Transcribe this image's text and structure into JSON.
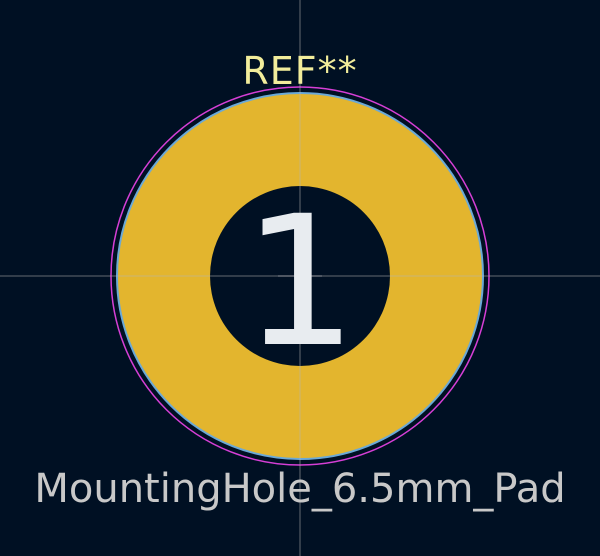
{
  "footprint": {
    "reference": "REF**",
    "value": "MountingHole_6.5mm_Pad",
    "pad_number": "1"
  },
  "colors": {
    "background": "#001023",
    "pad_copper": "#e3b52e",
    "pad_outline": "#6ba9d6",
    "courtyard": "#d63fd6",
    "drill_hole": "#001023",
    "crosshair": "#b4b4b4",
    "reference_text": "#f2ed9b",
    "value_text": "#c8c8c8",
    "pad_number_text": "#e8ecf0"
  },
  "icons": {
    "anchor": "crosshair-icon"
  }
}
